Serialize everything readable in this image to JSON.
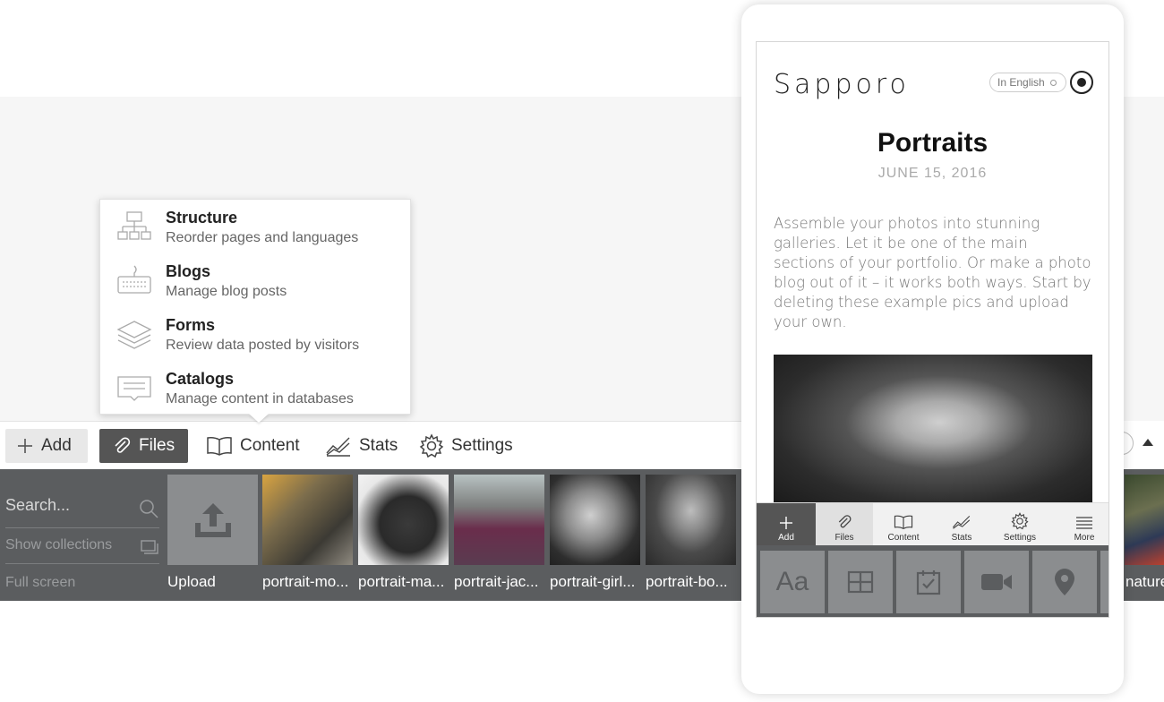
{
  "dropdown": {
    "items": [
      {
        "title": "Structure",
        "subtitle": "Reorder pages and languages"
      },
      {
        "title": "Blogs",
        "subtitle": "Manage blog posts"
      },
      {
        "title": "Forms",
        "subtitle": "Review data posted by visitors"
      },
      {
        "title": "Catalogs",
        "subtitle": "Manage content in databases"
      }
    ]
  },
  "toolbar": {
    "add_label": "Add",
    "files_label": "Files",
    "content_label": "Content",
    "stats_label": "Stats",
    "settings_label": "Settings"
  },
  "sidebar": {
    "search_placeholder": "Search...",
    "show_collections": "Show collections",
    "full_screen": "Full screen"
  },
  "files": {
    "upload_label": "Upload",
    "items": [
      {
        "name": "portrait-mo..."
      },
      {
        "name": "portrait-ma..."
      },
      {
        "name": "portrait-jac..."
      },
      {
        "name": "portrait-girl..."
      },
      {
        "name": "portrait-bo..."
      }
    ],
    "partial_right_label": "nature"
  },
  "phone": {
    "brand": "Sapporo",
    "language": "In English",
    "post_title": "Portraits",
    "post_date": "JUNE 15, 2016",
    "post_body": "Assemble your photos into stunning galleries. Let it be one of the main sections of your portfolio. Or make a photo blog out of it – it works both ways. Start by deleting these example pics and upload your own.",
    "toolbar": {
      "add": "Add",
      "files": "Files",
      "content": "Content",
      "stats": "Stats",
      "settings": "Settings",
      "more": "More"
    },
    "tray_text_tile": "Aa"
  }
}
